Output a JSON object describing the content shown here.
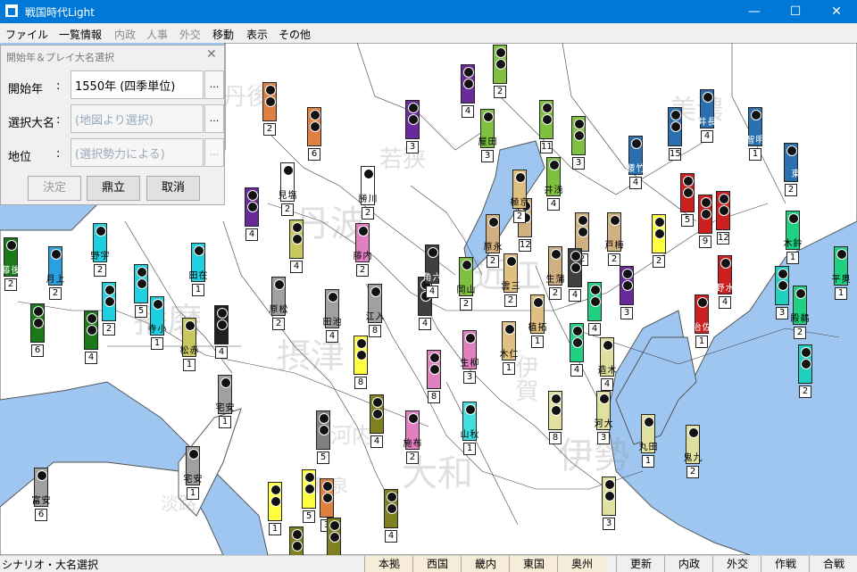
{
  "window": {
    "title": "戦国時代Light",
    "minimize": "—",
    "maximize": "☐",
    "close": "✕"
  },
  "menu": [
    "ファイル",
    "一覧情報",
    "内政",
    "人事",
    "外交",
    "移動",
    "表示",
    "その他"
  ],
  "menu_disabled": [
    false,
    false,
    true,
    true,
    true,
    false,
    false,
    false
  ],
  "map": {
    "colors": {
      "sea": "#9ec6f0",
      "land": "#ffffff",
      "border": "#333333"
    },
    "regions": [
      "丹後",
      "若狭",
      "美濃",
      "丹波",
      "播磨",
      "近江",
      "摂津",
      "伊賀",
      "大和",
      "伊勢",
      "淡路",
      "河内",
      "和泉"
    ],
    "castles": [
      {
        "name": "後藤",
        "num": "2",
        "color": "#1a7a1a"
      },
      {
        "name": "上月",
        "num": "2",
        "color": "#2aa0e0"
      },
      {
        "name": "宇野",
        "num": "2",
        "color": "#1fd0e0"
      },
      {
        "name": "",
        "num": "4",
        "color": "#1a7a1a"
      },
      {
        "name": "",
        "num": "6",
        "color": "#1a7a1a"
      },
      {
        "name": "",
        "num": "2",
        "color": "#1fd0e0"
      },
      {
        "name": "",
        "num": "5",
        "color": "#1fd0e0"
      },
      {
        "name": "小寺",
        "num": "1",
        "color": "#1fd0e0"
      },
      {
        "name": "赤松",
        "num": "1",
        "color": "#c8c860"
      },
      {
        "name": "",
        "num": "4",
        "color": "#202020"
      },
      {
        "name": "",
        "num": "2",
        "color": "#e08040"
      },
      {
        "name": "",
        "num": "6",
        "color": "#e08040"
      },
      {
        "name": "塩見",
        "num": "2",
        "color": "#ffffff"
      },
      {
        "name": "川勝",
        "num": "2",
        "color": "#ffffff"
      },
      {
        "name": "",
        "num": "4",
        "color": "#6a2a9a"
      },
      {
        "name": "",
        "num": "4",
        "color": "#c8c860"
      },
      {
        "name": "内藤",
        "num": "2",
        "color": "#e080c0"
      },
      {
        "name": "在田",
        "num": "1",
        "color": "#1fd0e0"
      },
      {
        "name": "松原",
        "num": "2",
        "color": "#a0a0a0"
      },
      {
        "name": "池田",
        "num": "4",
        "color": "#a0a0a0"
      },
      {
        "name": "入江",
        "num": "8",
        "color": "#a0a0a0"
      },
      {
        "name": "安宅",
        "num": "1",
        "color": "#a0a0a0"
      },
      {
        "name": "安宅",
        "num": "1",
        "color": "#a0a0a0"
      },
      {
        "name": "安富",
        "num": "6",
        "color": "#a0a0a0"
      },
      {
        "name": "",
        "num": "5",
        "color": "#808080"
      },
      {
        "name": "",
        "num": "8",
        "color": "#ffff40"
      },
      {
        "name": "",
        "num": "4",
        "color": "#808020"
      },
      {
        "name": "",
        "num": "8",
        "color": "#e080c0"
      },
      {
        "name": "布施",
        "num": "2",
        "color": "#e080c0"
      },
      {
        "name": "",
        "num": "4",
        "color": "#404040"
      },
      {
        "name": "",
        "num": "5",
        "color": "#ffff40"
      },
      {
        "name": "秋山",
        "num": "1",
        "color": "#40e0e0"
      },
      {
        "name": "柳生",
        "num": "3",
        "color": "#e080c0"
      },
      {
        "name": "山岡",
        "num": "2",
        "color": "#80c040"
      },
      {
        "name": "三雲",
        "num": "2",
        "color": "#e0c080"
      },
      {
        "name": "永原",
        "num": "2",
        "color": "#d0b080"
      },
      {
        "name": "",
        "num": "12",
        "color": "#d0b080"
      },
      {
        "name": "蒲生",
        "num": "2",
        "color": "#d0b080"
      },
      {
        "name": "仁木",
        "num": "1",
        "color": "#e0c080"
      },
      {
        "name": "拓植",
        "num": "1",
        "color": "#e0c080"
      },
      {
        "name": "",
        "num": "4",
        "color": "#1fd080"
      },
      {
        "name": "",
        "num": "4",
        "color": "#1fd080"
      },
      {
        "name": "木造",
        "num": "4",
        "color": "#e0e0a0"
      },
      {
        "name": "大河",
        "num": "3",
        "color": "#e0e0a0"
      },
      {
        "name": "田丸",
        "num": "1",
        "color": "#e0e0a0"
      },
      {
        "name": "九鬼",
        "num": "2",
        "color": "#e0e0a0"
      },
      {
        "name": "",
        "num": "8",
        "color": "#e0e0a0"
      },
      {
        "name": "",
        "num": "3",
        "color": "#e0e0a0"
      },
      {
        "name": "梅戸",
        "num": "2",
        "color": "#d0b080"
      },
      {
        "name": "",
        "num": "2",
        "color": "#d0b080"
      },
      {
        "name": "",
        "num": "4",
        "color": "#404040"
      },
      {
        "name": "",
        "num": "3",
        "color": "#6a2a9a"
      },
      {
        "name": "",
        "num": "2",
        "color": "#ffff40"
      },
      {
        "name": "",
        "num": "5",
        "color": "#cc2020"
      },
      {
        "name": "",
        "num": "9",
        "color": "#cc2020"
      },
      {
        "name": "",
        "num": "12",
        "color": "#cc2020"
      },
      {
        "name": "水野",
        "num": "4",
        "color": "#cc2020"
      },
      {
        "name": "佐治",
        "num": "1",
        "color": "#cc2020"
      },
      {
        "name": "竹腰",
        "num": "4",
        "color": "#2a70b0"
      },
      {
        "name": "",
        "num": "15",
        "color": "#2a70b0"
      },
      {
        "name": "長井",
        "num": "4",
        "color": "#2a70b0"
      },
      {
        "name": "明智",
        "num": "1",
        "color": "#2a70b0"
      },
      {
        "name": "東",
        "num": "2",
        "color": "#2a70b0"
      },
      {
        "name": "",
        "num": "3",
        "color": "#6a2a9a"
      },
      {
        "name": "",
        "num": "4",
        "color": "#6a2a9a"
      },
      {
        "name": "",
        "num": "3",
        "color": "#e08040"
      },
      {
        "name": "田屋",
        "num": "3",
        "color": "#80c040"
      },
      {
        "name": "",
        "num": "2",
        "color": "#80c040"
      },
      {
        "name": "",
        "num": "11",
        "color": "#80c040"
      },
      {
        "name": "",
        "num": "3",
        "color": "#80c040"
      },
      {
        "name": "浅井",
        "num": "4",
        "color": "#80c040"
      },
      {
        "name": "京極",
        "num": "2",
        "color": "#e0c080"
      },
      {
        "name": "六角",
        "num": "4",
        "color": "#404040"
      },
      {
        "name": "鈴木",
        "num": "1",
        "color": "#1fd080"
      },
      {
        "name": "奥平",
        "num": "1",
        "color": "#1fd080"
      },
      {
        "name": "鵜殿",
        "num": "2",
        "color": "#1fd080"
      },
      {
        "name": "",
        "num": "3",
        "color": "#1fd0c0"
      },
      {
        "name": "",
        "num": "2",
        "color": "#1fd0c0"
      },
      {
        "name": "",
        "num": "4",
        "color": "#808020"
      },
      {
        "name": "",
        "num": "1",
        "color": "#ffff40"
      },
      {
        "name": "",
        "num": "2",
        "color": "#808020"
      },
      {
        "name": "",
        "num": "3",
        "color": "#808020"
      }
    ]
  },
  "dialog": {
    "title": "開始年＆プレイ大名選択",
    "close": "✕",
    "rows": [
      {
        "label": "開始年",
        "colon": ":",
        "value": "1550年 (四季単位)",
        "more": "..."
      },
      {
        "label": "選択大名",
        "colon": ":",
        "value": "(地図より選択)",
        "more": "..."
      },
      {
        "label": "地位",
        "colon": ":",
        "value": "(選択勢力による)",
        "more": "..."
      }
    ],
    "buttons": {
      "decide": "決定",
      "kanritsu": "鼎立",
      "cancel": "取消"
    }
  },
  "status": {
    "text": "シナリオ・大名選択",
    "regions": [
      "本拠",
      "西国",
      "畿内",
      "東国",
      "奥州"
    ],
    "actions": [
      "更新",
      "内政",
      "外交",
      "作戦",
      "合戦"
    ]
  }
}
